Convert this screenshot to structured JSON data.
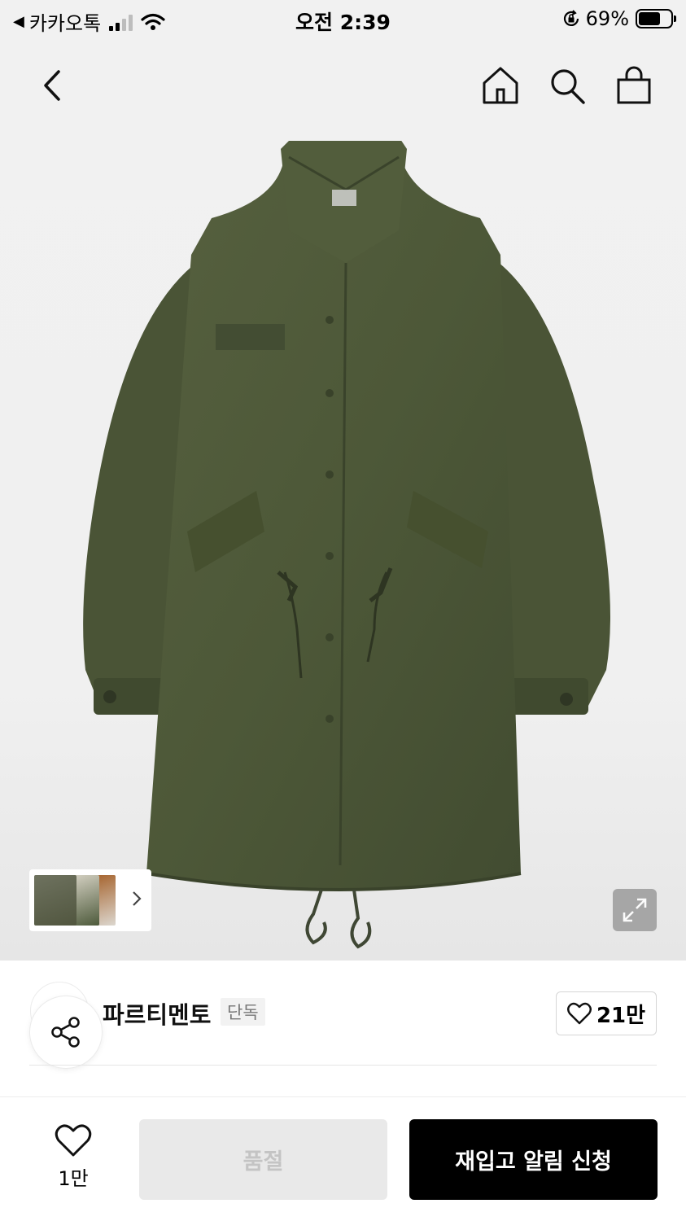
{
  "status_bar": {
    "back_app": "카카오톡",
    "time": "오전 2:39",
    "battery": "69%",
    "battery_level": 0.69
  },
  "nav": {
    "icons": [
      "back-chevron-icon",
      "home-icon",
      "search-icon",
      "shopping-bag-icon"
    ]
  },
  "product": {
    "image_icon": "olive-fishtail-parka",
    "thumbnails": [
      "thumb-front",
      "thumb-model",
      "thumb-detail"
    ]
  },
  "brand": {
    "name": "파르티멘토",
    "tag": "단독",
    "likes": "21만"
  },
  "bottom": {
    "wish_count": "1만",
    "soldout_label": "품절",
    "restock_label": "재입고 알림 신청"
  },
  "colors": {
    "jacket": "#4e5a3c",
    "primary_button": "#000000",
    "disabled_button": "#e9e9e9"
  }
}
